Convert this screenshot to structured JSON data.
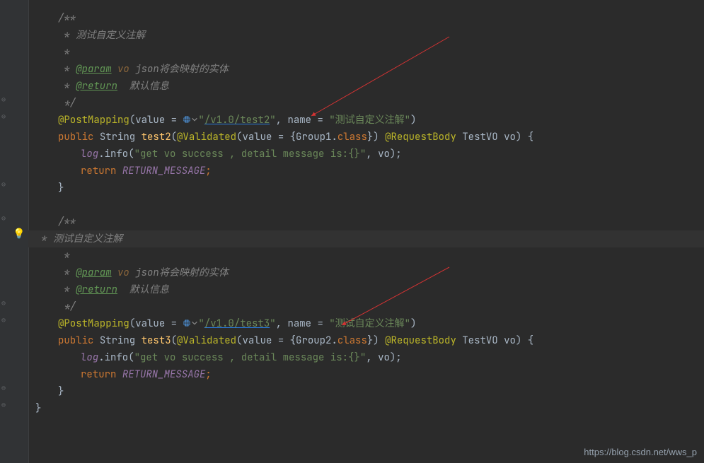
{
  "block1": {
    "doc_open": "/**",
    "doc_line1": " * 测试自定义注解",
    "doc_blank": " *",
    "doc_param_tag": "@param",
    "doc_param_name": "vo",
    "doc_param_desc": "json将会映射的实体",
    "doc_return_tag": "@return",
    "doc_return_desc": "默认信息",
    "doc_close": " */",
    "ann_post": "@PostMapping",
    "ann_value_kw": "value = ",
    "url": "/v1.0/test2",
    "name_kw": "name",
    "name_val": "测试自定义注解",
    "kw_public": "public",
    "type_string": "String",
    "method": "test2",
    "ann_validated": "@Validated",
    "validated_value_kw": "value = ",
    "group_name": "Group1",
    "class_kw": "class",
    "ann_reqbody": "@RequestBody",
    "param_type": "TestVO",
    "param_name": "vo",
    "log_obj": "log",
    "log_method": "info",
    "log_msg": "get vo success , detail message is:{}",
    "log_arg": "vo",
    "kw_return": "return",
    "return_var": "RETURN_MESSAGE"
  },
  "block2": {
    "doc_open": "/**",
    "doc_line1": " * 测试自定义注解",
    "doc_blank": " *",
    "doc_param_tag": "@param",
    "doc_param_name": "vo",
    "doc_param_desc": "json将会映射的实体",
    "doc_return_tag": "@return",
    "doc_return_desc": "默认信息",
    "doc_close": " */",
    "ann_post": "@PostMapping",
    "ann_value_kw": "value = ",
    "url": "/v1.0/test3",
    "name_kw": "name",
    "name_val": "测试自定义注解",
    "kw_public": "public",
    "type_string": "String",
    "method": "test3",
    "ann_validated": "@Validated",
    "validated_value_kw": "value = ",
    "group_name": "Group2",
    "class_kw": "class",
    "ann_reqbody": "@RequestBody",
    "param_type": "TestVO",
    "param_name": "vo",
    "log_obj": "log",
    "log_method": "info",
    "log_msg": "get vo success , detail message is:{}",
    "log_arg": "vo",
    "kw_return": "return",
    "return_var": "RETURN_MESSAGE"
  },
  "close_brace": "}",
  "watermark": "https://blog.csdn.net/wws_p"
}
